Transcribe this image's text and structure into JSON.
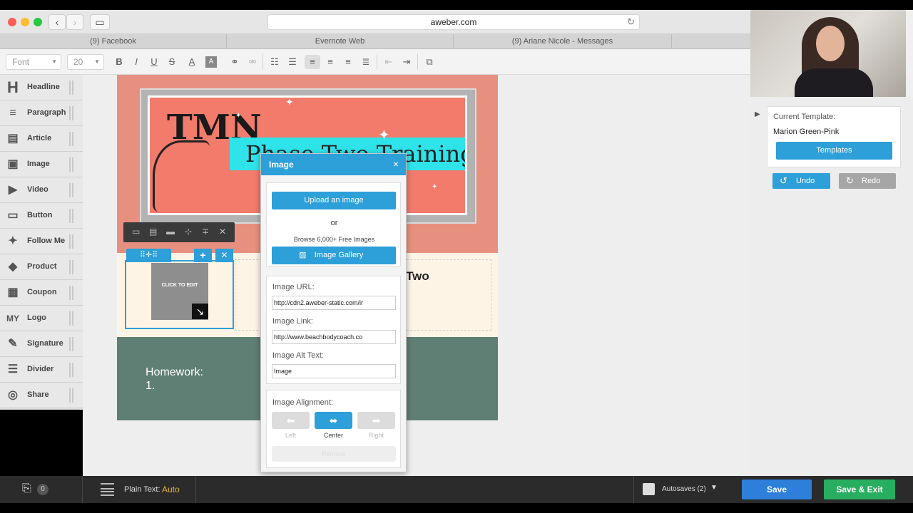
{
  "browser": {
    "url": "aweber.com",
    "tabs": [
      "(9) Facebook",
      "Evernote Web",
      "(9) Ariane Nicole - Messages"
    ]
  },
  "toolbar": {
    "font_select": "Font",
    "size_select": "20",
    "bold": "B",
    "italic": "I",
    "underline": "U",
    "strike": "S",
    "text_color": "A",
    "bg_color": "A"
  },
  "sidebar": {
    "items": [
      {
        "label": "Headline",
        "icon": "H"
      },
      {
        "label": "Paragraph",
        "icon": "≡"
      },
      {
        "label": "Article",
        "icon": "▤"
      },
      {
        "label": "Image",
        "icon": "▣"
      },
      {
        "label": "Video",
        "icon": "▶"
      },
      {
        "label": "Button",
        "icon": "▭"
      },
      {
        "label": "Follow Me",
        "icon": "✦"
      },
      {
        "label": "Product",
        "icon": "◆"
      },
      {
        "label": "Coupon",
        "icon": "▦"
      },
      {
        "label": "Logo",
        "icon": "MY"
      },
      {
        "label": "Signature",
        "icon": "✎"
      },
      {
        "label": "Divider",
        "icon": "☰"
      },
      {
        "label": "Share",
        "icon": "◎"
      }
    ]
  },
  "email": {
    "banner_tmn": "TMN",
    "banner_title": "Phase Two Training",
    "placeholder_text": "CLICK TO EDIT",
    "content_heading": "Two",
    "homework_line1": "Homework:",
    "homework_line2": "1."
  },
  "image_dialog": {
    "title": "Image",
    "upload_button": "Upload an image",
    "or_text": "or",
    "browse_text": "Browse 6,000+ Free Images",
    "gallery_button": "Image Gallery",
    "url_label": "Image URL:",
    "url_value": "http://cdn2.aweber-static.com/ir",
    "link_label": "Image Link:",
    "link_value": "http://www.beachbodycoach.co",
    "alt_label": "Image Alt Text:",
    "alt_value": "Image",
    "alignment_label": "Image Alignment:",
    "align_left": "Left",
    "align_center": "Center",
    "align_right": "Right",
    "remove_button": "Remove"
  },
  "right_panel": {
    "current_template_label": "Current Template:",
    "template_name": "Marion Green-Pink",
    "templates_button": "Templates",
    "undo_button": "Undo",
    "redo_button": "Redo"
  },
  "bottom_bar": {
    "attachment_count": "0",
    "plain_text_label": "Plain Text:",
    "plain_text_value": "Auto",
    "autosaves_label": "Autosaves (2)",
    "save_button": "Save",
    "save_exit_button": "Save & Exit"
  },
  "colors": {
    "accent_blue": "#2d9fd9",
    "save_blue": "#2d7fd9",
    "save_exit_green": "#27ae60",
    "header_salmon": "#e8907f",
    "footer_green": "#5f7f74"
  }
}
